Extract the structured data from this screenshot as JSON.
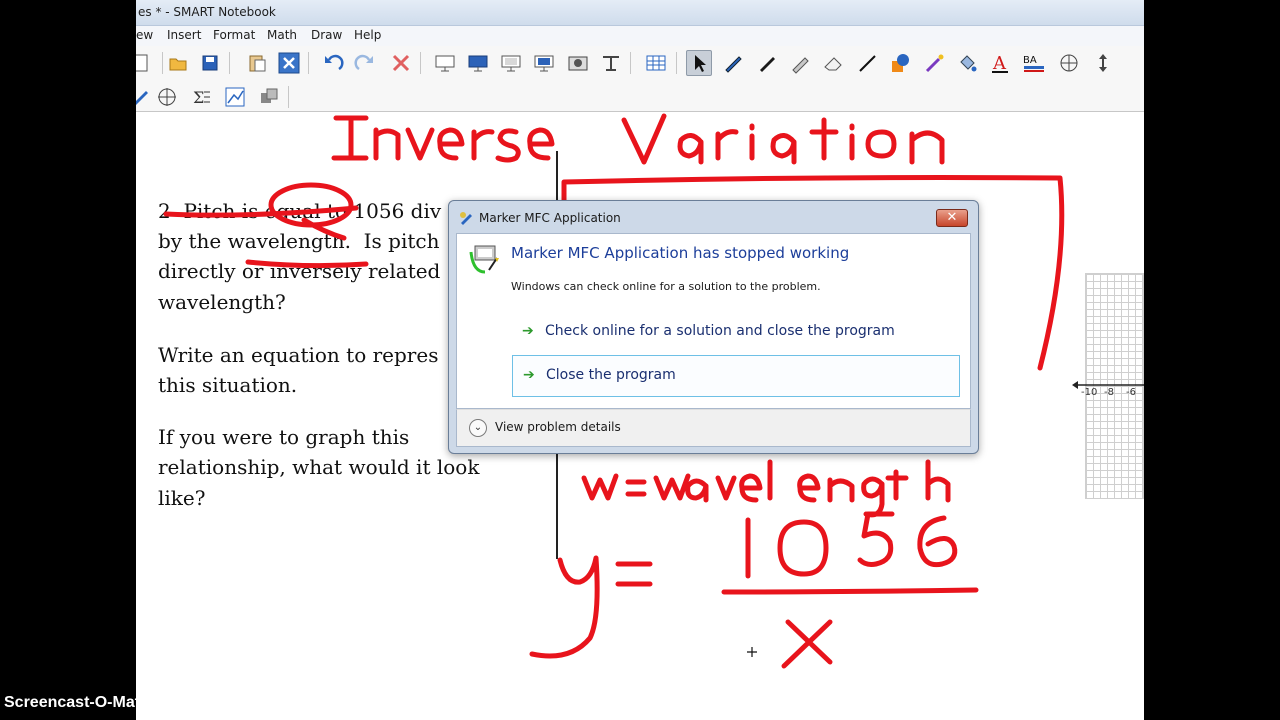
{
  "window": {
    "title": "es * - SMART Notebook"
  },
  "menu": [
    "ew",
    "Insert",
    "Format",
    "Math",
    "Draw",
    "Help"
  ],
  "toolbar1_icons": [
    "new-page-icon",
    "open-icon",
    "save-icon",
    "paste-icon",
    "delete-icon",
    "undo-icon",
    "redo-icon",
    "delete-x-icon",
    "screen-shade-icon",
    "full-screen-icon",
    "display-icon",
    "dual-display-icon",
    "camera-icon",
    "capture-icon",
    "table-icon",
    "select-icon",
    "pen-icon",
    "creative-pen-icon",
    "highlighter-icon",
    "eraser-icon",
    "line-icon",
    "shapes-icon",
    "magic-pen-icon",
    "fill-icon",
    "text-icon",
    "properties-icon",
    "move-toolbar-icon"
  ],
  "toolbar2_icons": [
    "page-sorter-icon",
    "measurement-icon",
    "equation-icon",
    "graph-icon",
    "add-ons-icon"
  ],
  "question": {
    "lines": [
      "2  Pitch is equal to 1056 div",
      "by the wavelength.  Is pitch",
      "directly or inversely related",
      "wavelength?",
      "",
      "Write an equation to repres",
      "this situation.",
      "",
      "If you were to graph this",
      "relationship, what would it look",
      "like?"
    ]
  },
  "graph_ticks": [
    "-10",
    "-8",
    "-6"
  ],
  "dialog": {
    "title": "Marker MFC Application",
    "close": "✕",
    "heading": "Marker MFC Application has stopped working",
    "subtext": "Windows can check online for a solution to the problem.",
    "option1": "Check online for a solution and close the program",
    "option2": "Close the program",
    "details": "View problem details"
  },
  "handwriting": {
    "title": "Inverse Variation",
    "line1": "w = wavelength",
    "equation": "y = 1056 / x"
  },
  "watermark": "Screencast-O-Matic.com",
  "colors": {
    "ink_red": "#e8141c",
    "dialog_heading": "#1c3e9a",
    "option_arrow": "#2e9a2e"
  }
}
